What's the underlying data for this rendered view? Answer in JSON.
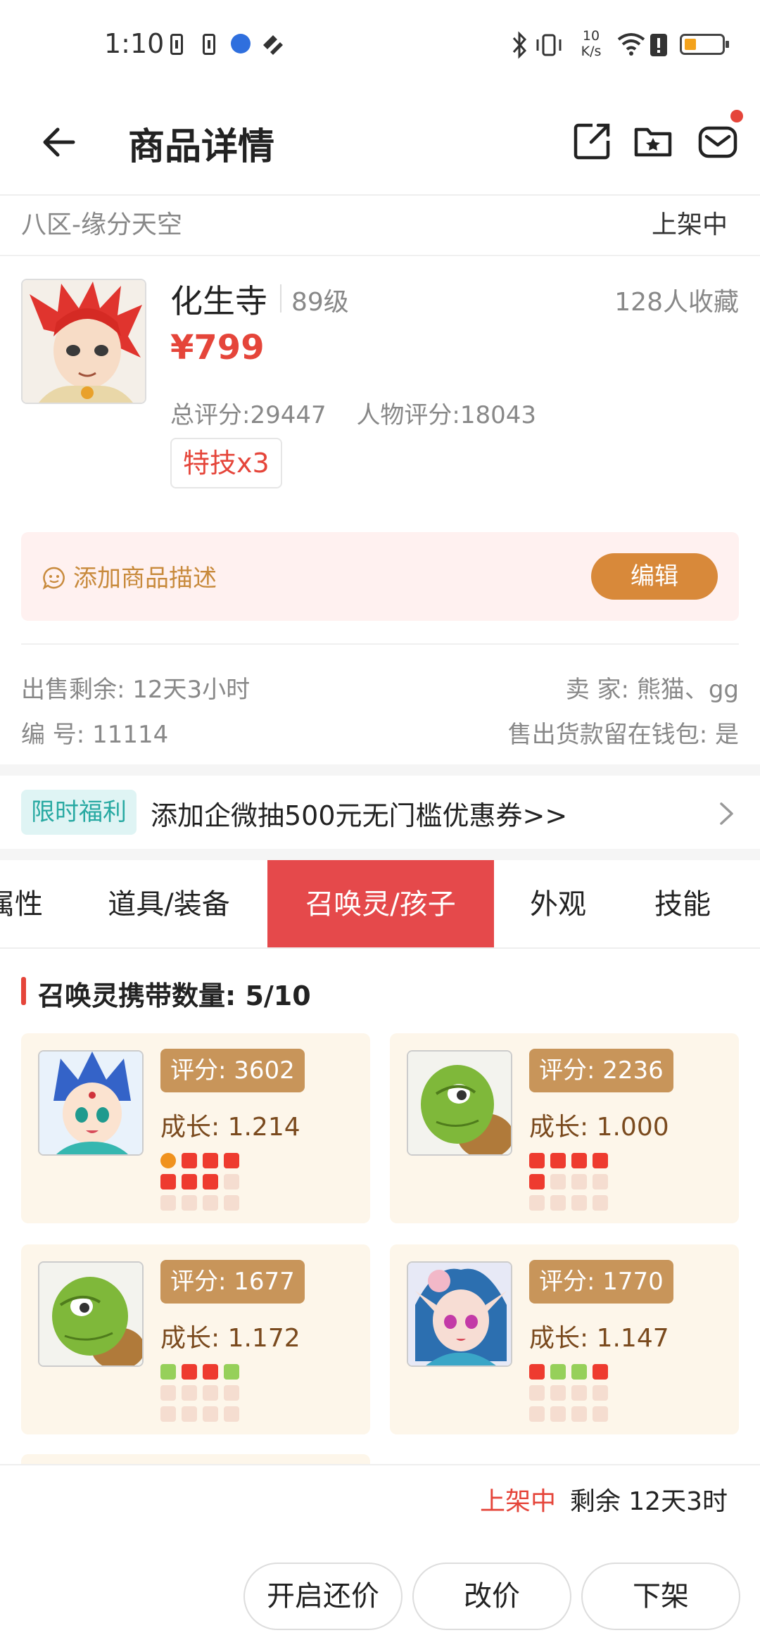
{
  "status_bar": {
    "time": "1:10",
    "net_speed_value": "10",
    "net_speed_unit": "K/s",
    "battery_level": 0.2,
    "battery_color": "#f3a21c"
  },
  "header": {
    "title": "商品详情",
    "back_icon": "back-arrow-icon",
    "share_icon": "share-icon",
    "favorite_icon": "folder-star-icon",
    "mail_icon": "mail-icon",
    "mail_badge_color": "#e5453a"
  },
  "listing": {
    "server": "八区-缘分天空",
    "status": "上架中"
  },
  "product": {
    "name": "化生寺",
    "level": "89级",
    "favorites": "128人收藏",
    "price": "¥799",
    "total_score": "总评分:29447",
    "char_score": "人物评分:18043",
    "skill_tag": "特技x3"
  },
  "description": {
    "placeholder": "添加商品描述",
    "edit_label": "编辑"
  },
  "info": {
    "remaining_label": "出售剩余:",
    "remaining_value": "12天3小时",
    "seller_label": "卖  家:",
    "seller_value": "熊猫、gg",
    "id_label": "编  号:",
    "id_value": "11114",
    "wallet_label": "售出货款留在钱包:",
    "wallet_value": "是"
  },
  "promo": {
    "badge": "限时福利",
    "text": "添加企微抽500元无门槛优惠券>>"
  },
  "tabs": [
    {
      "label": "属性"
    },
    {
      "label": "道具/装备"
    },
    {
      "label": "召唤灵/孩子"
    },
    {
      "label": "外观"
    },
    {
      "label": "技能"
    }
  ],
  "active_tab": "召唤灵/孩子",
  "pets_section": {
    "title": "召唤灵携带数量:",
    "count": "5/10"
  },
  "pets": [
    {
      "score": "评分: 3602",
      "growth": "成长: 1.214",
      "skills": [
        "orange",
        "red",
        "red",
        "red",
        "red",
        "red",
        "red",
        "empty",
        "empty",
        "empty",
        "empty",
        "empty"
      ]
    },
    {
      "score": "评分: 2236",
      "growth": "成长: 1.000",
      "skills": [
        "red",
        "red",
        "red",
        "red",
        "red",
        "empty",
        "empty",
        "empty",
        "empty",
        "empty",
        "empty",
        "empty"
      ]
    },
    {
      "score": "评分: 1677",
      "growth": "成长: 1.172",
      "skills": [
        "green",
        "red",
        "red",
        "green",
        "empty",
        "empty",
        "empty",
        "empty",
        "empty",
        "empty",
        "empty",
        "empty"
      ]
    },
    {
      "score": "评分: 1770",
      "growth": "成长: 1.147",
      "skills": [
        "red",
        "green",
        "green",
        "red",
        "empty",
        "empty",
        "empty",
        "empty",
        "empty",
        "empty",
        "empty",
        "empty"
      ]
    }
  ],
  "bottom_bar": {
    "status": "上架中",
    "remaining": "剩余 12天3时",
    "buttons": [
      "开启还价",
      "改价",
      "下架"
    ]
  },
  "colors": {
    "accent_red": "#e5453a",
    "tab_active": "#e5494b",
    "edit_button": "#d8893a",
    "score_badge": "#c8955a",
    "promo_badge_bg": "#dff4f4",
    "promo_badge_text": "#28a9a2",
    "skill_red": "#ee3b2f",
    "skill_green": "#96d05a",
    "skill_orange": "#f0921e",
    "skill_empty": "#f5ddd0"
  }
}
